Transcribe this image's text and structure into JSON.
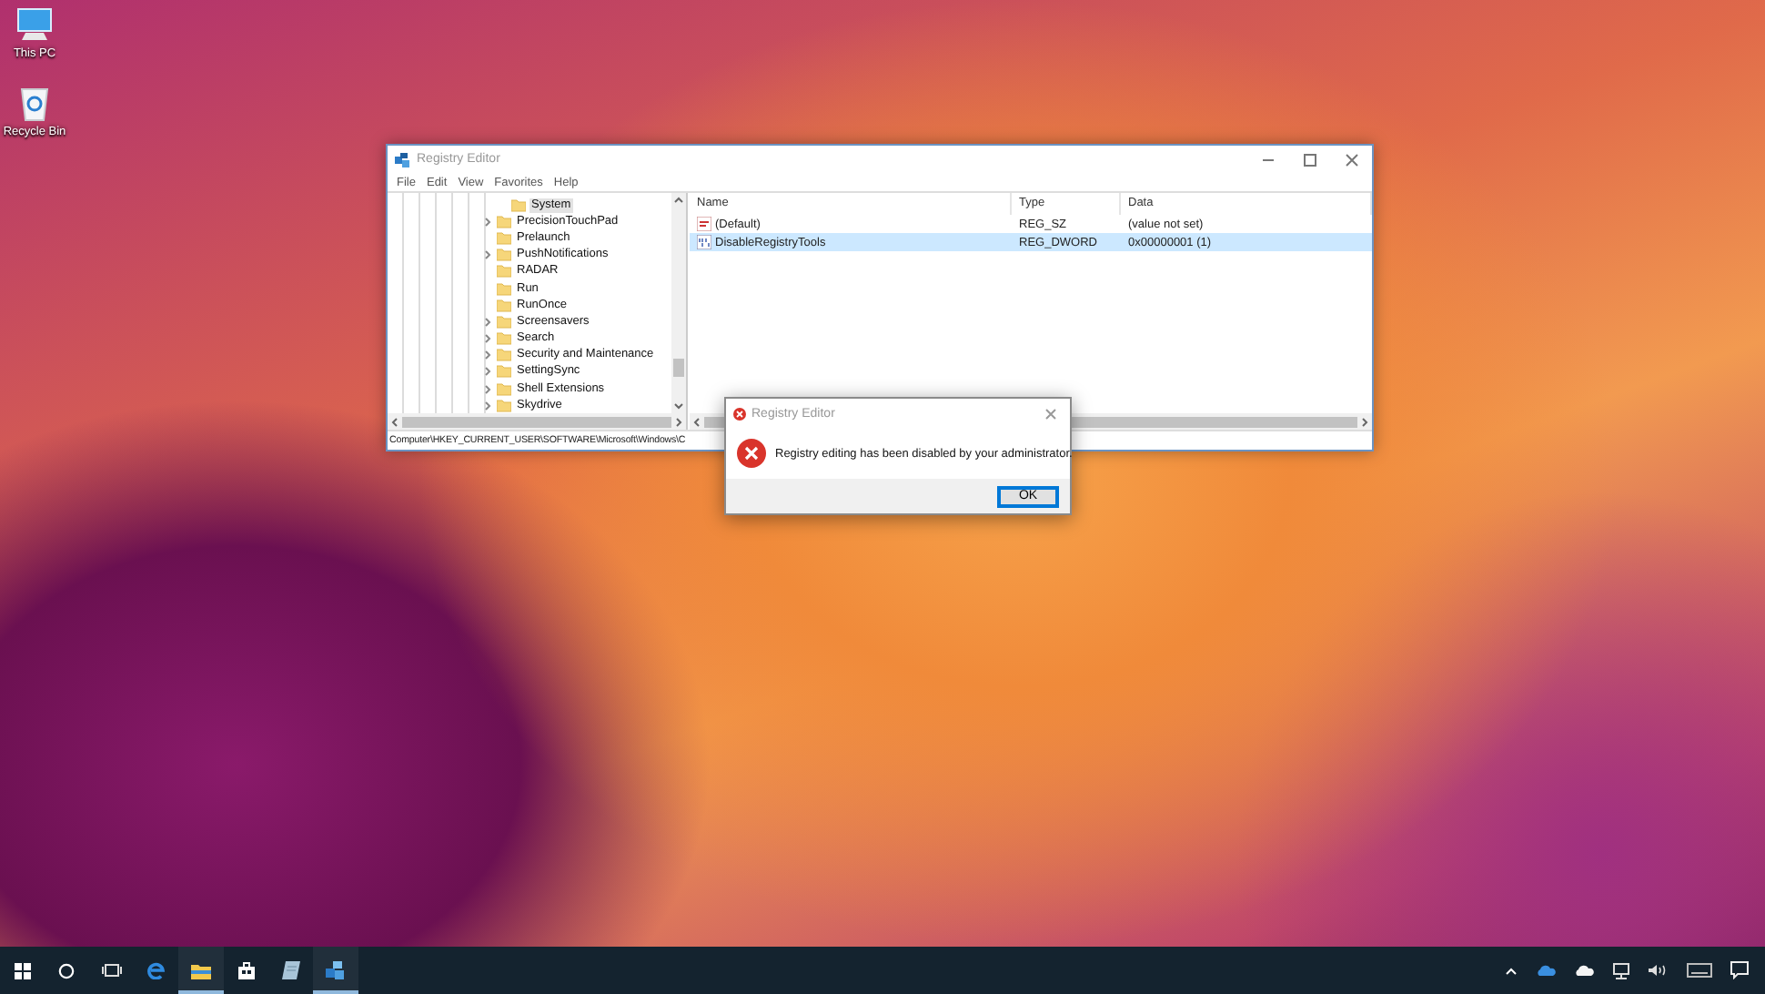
{
  "desktop": {
    "icons": [
      {
        "kind": "computer",
        "label": "This PC"
      },
      {
        "kind": "recycle-bin",
        "label": "Recycle Bin"
      }
    ]
  },
  "registry_editor": {
    "title": "Registry Editor",
    "menu": [
      "File",
      "Edit",
      "View",
      "Favorites",
      "Help"
    ],
    "tree": {
      "children_of_hidden_key": [
        {
          "label": "System",
          "selected": true
        }
      ],
      "items": [
        {
          "label": "PrecisionTouchPad",
          "expandable": true,
          "selected": false
        },
        {
          "label": "Prelaunch",
          "expandable": false,
          "selected": false
        },
        {
          "label": "PushNotifications",
          "expandable": true,
          "selected": false
        },
        {
          "label": "RADAR",
          "expandable": false,
          "selected": false
        },
        {
          "label": "Run",
          "expandable": false,
          "selected": false
        },
        {
          "label": "RunOnce",
          "expandable": false,
          "selected": false
        },
        {
          "label": "Screensavers",
          "expandable": true,
          "selected": false
        },
        {
          "label": "Search",
          "expandable": true,
          "selected": false
        },
        {
          "label": "Security and Maintenance",
          "expandable": true,
          "selected": false
        },
        {
          "label": "SettingSync",
          "expandable": true,
          "selected": false
        },
        {
          "label": "Shell Extensions",
          "expandable": true,
          "selected": false
        },
        {
          "label": "Skydrive",
          "expandable": true,
          "selected": false
        }
      ]
    },
    "values": {
      "columns": [
        "Name",
        "Type",
        "Data"
      ],
      "rows": [
        {
          "kind": "string",
          "name": "(Default)",
          "type": "REG_SZ",
          "data": "(value not set)",
          "selected": false
        },
        {
          "kind": "binary",
          "name": "DisableRegistryTools",
          "type": "REG_DWORD",
          "data": "0x00000001 (1)",
          "selected": true
        }
      ]
    },
    "status_bar": "Computer\\HKEY_CURRENT_USER\\SOFTWARE\\Microsoft\\Windows\\C"
  },
  "dialog": {
    "title": "Registry Editor",
    "message": "Registry editing has been disabled by your administrator.",
    "buttons": [
      {
        "label": "OK",
        "default": true
      }
    ]
  },
  "taskbar": {
    "items": [
      {
        "kind": "start",
        "open": false
      },
      {
        "kind": "search",
        "open": false
      },
      {
        "kind": "task-view",
        "open": false
      },
      {
        "kind": "browser",
        "open": false
      },
      {
        "kind": "folder",
        "open": true
      },
      {
        "kind": "store",
        "open": false
      },
      {
        "kind": "notepad",
        "open": false
      },
      {
        "kind": "registry",
        "open": true
      }
    ],
    "tray": [
      {
        "kind": "chevron"
      },
      {
        "kind": "onedrive"
      },
      {
        "kind": "cloud"
      },
      {
        "kind": "network"
      },
      {
        "kind": "volume"
      },
      {
        "kind": "keyboard"
      },
      {
        "kind": "notifications"
      }
    ]
  }
}
